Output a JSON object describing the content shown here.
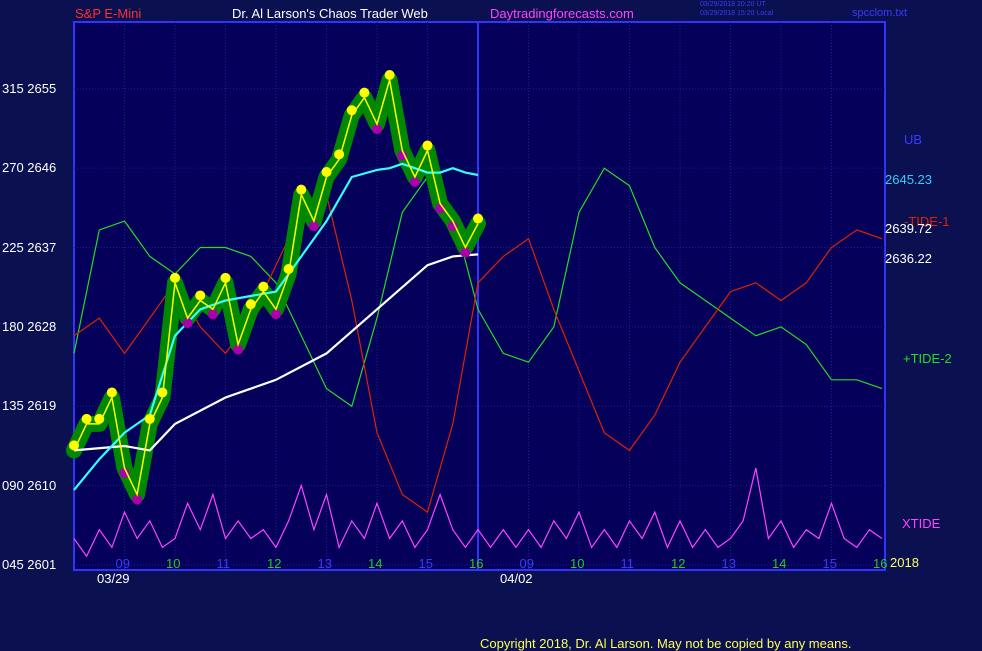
{
  "header": {
    "symbol": "S&P E-Mini",
    "title": "Dr. Al Larson's Chaos Trader Web",
    "site": "Daytradingforecasts.com",
    "time_ut": "03/29/2018 20:20 UT",
    "time_local": "03/29/2018 15:20 Local",
    "file": "spcclom.txt"
  },
  "footer": {
    "copyright": "Copyright 2018, Dr. Al Larson. May not be copied by any means."
  },
  "year_label": "2018",
  "colors": {
    "background": "#0a1050",
    "plot_bg": "#05005a",
    "price_bars": "#008800",
    "price_highs": "#ffff00",
    "price_lows": "#aa00aa",
    "emini_line": "#ffff00",
    "cyan_avg": "#33ffff",
    "white_avg": "#ffffff",
    "tide1": "#dd2200",
    "tide2": "#22dd22",
    "xtide": "#ff44ff",
    "axis": "#3333ff"
  },
  "chart_data": {
    "type": "line",
    "y_left_ticks": [
      {
        "osc": "045",
        "price": "2601"
      },
      {
        "osc": "090",
        "price": "2610"
      },
      {
        "osc": "135",
        "price": "2619"
      },
      {
        "osc": "180",
        "price": "2628"
      },
      {
        "osc": "225",
        "price": "2637"
      },
      {
        "osc": "270",
        "price": "2646"
      },
      {
        "osc": "315",
        "price": "2655"
      }
    ],
    "ylim_price": [
      2601,
      2656
    ],
    "x_hour_labels": [
      "09",
      "10",
      "11",
      "12",
      "13",
      "14",
      "15",
      "16",
      "09",
      "10",
      "11",
      "12",
      "13",
      "14",
      "15",
      "16"
    ],
    "x_date_labels": [
      "03/29",
      "04/02"
    ],
    "now_index": 8,
    "right_labels": {
      "ub": "UB",
      "cyan_value": "2645.23",
      "tide1": "-TIDE-1",
      "last_price": "2639.72",
      "white_value": "2636.22",
      "tide2": "+TIDE-2",
      "xtide": "XTIDE"
    },
    "series": [
      {
        "key": "price",
        "x": [
          0,
          0.25,
          0.5,
          0.75,
          1,
          1.25,
          1.5,
          1.75,
          2,
          2.25,
          2.5,
          2.75,
          3,
          3.25,
          3.5,
          3.75,
          4,
          4.25,
          4.5,
          4.75,
          5,
          5.25,
          5.5,
          5.75,
          6,
          6.25,
          6.5,
          6.75,
          7,
          7.25,
          7.5,
          7.75,
          8
        ],
        "y": [
          2614,
          2617,
          2617,
          2620,
          2612,
          2609,
          2617,
          2620,
          2633,
          2629,
          2631,
          2630,
          2633,
          2626,
          2630,
          2632,
          2630,
          2634,
          2643,
          2640,
          2645,
          2647,
          2652,
          2654,
          2651,
          2656,
          2648,
          2645,
          2648,
          2642,
          2640,
          2637,
          2639.72
        ]
      },
      {
        "key": "cyan",
        "x": [
          0,
          0.5,
          1,
          1.5,
          2,
          2.5,
          3,
          3.5,
          4,
          4.5,
          5,
          5.5,
          6,
          6.25,
          6.5,
          6.75,
          7,
          7.25,
          7.5,
          7.75,
          8
        ],
        "y": [
          2609.5,
          2613,
          2616,
          2618,
          2627,
          2630,
          2631,
          2631.5,
          2632,
          2636,
          2640,
          2645,
          2645.8,
          2646,
          2646.5,
          2646,
          2645.5,
          2645.5,
          2646,
          2645.5,
          2645.23
        ]
      },
      {
        "key": "white",
        "x": [
          0,
          1,
          1.5,
          2,
          3,
          4,
          5,
          6,
          7,
          7.5,
          8
        ],
        "y": [
          2614,
          2614.5,
          2614,
          2617,
          2620,
          2622,
          2625,
          2630,
          2635,
          2636,
          2636.22
        ]
      },
      {
        "key": "tide1",
        "x": [
          0,
          0.5,
          1,
          1.5,
          2,
          2.5,
          3,
          3.5,
          4,
          4.5,
          5,
          5.5,
          6,
          6.5,
          7,
          7.5,
          8,
          8.5,
          9,
          9.5,
          10,
          10.5,
          11,
          11.5,
          12,
          12.5,
          13,
          13.5,
          14,
          14.5,
          15,
          15.5,
          16
        ],
        "y": [
          2627,
          2629,
          2625,
          2629,
          2633,
          2628,
          2625,
          2629,
          2635,
          2641,
          2643,
          2631,
          2616,
          2609,
          2607,
          2617,
          2633,
          2636,
          2638,
          2630,
          2623,
          2616,
          2614,
          2618,
          2624,
          2628,
          2632,
          2633,
          2631,
          2633,
          2637,
          2639,
          2638
        ]
      },
      {
        "key": "tide2",
        "x": [
          0,
          0.5,
          1,
          1.5,
          2,
          2.5,
          3,
          3.5,
          4,
          4.5,
          5,
          5.5,
          6,
          6.5,
          7,
          7.5,
          8,
          8.5,
          9,
          9.5,
          10,
          10.5,
          11,
          11.5,
          12,
          12.5,
          13,
          13.5,
          14,
          14.5,
          15,
          15.5,
          16
        ],
        "y": [
          2625,
          2639,
          2640,
          2636,
          2634,
          2637,
          2637,
          2636,
          2633,
          2627,
          2621,
          2619,
          2629,
          2641,
          2645,
          2641,
          2630,
          2625,
          2624,
          2628,
          2641,
          2646,
          2644,
          2637,
          2633,
          2631,
          2629,
          2627,
          2628,
          2626,
          2622,
          2622,
          2621
        ]
      },
      {
        "key": "xtide",
        "x": [
          0,
          0.25,
          0.5,
          0.75,
          1,
          1.25,
          1.5,
          1.75,
          2,
          2.25,
          2.5,
          2.75,
          3,
          3.25,
          3.5,
          3.75,
          4,
          4.25,
          4.5,
          4.75,
          5,
          5.25,
          5.5,
          5.75,
          6,
          6.25,
          6.5,
          6.75,
          7,
          7.25,
          7.5,
          7.75,
          8,
          8.25,
          8.5,
          8.75,
          9,
          9.25,
          9.5,
          9.75,
          10,
          10.25,
          10.5,
          10.75,
          11,
          11.25,
          11.5,
          11.75,
          12,
          12.25,
          12.5,
          12.75,
          13,
          13.25,
          13.5,
          13.75,
          14,
          14.25,
          14.5,
          14.75,
          15,
          15.25,
          15.5,
          15.75,
          16
        ],
        "y": [
          2604,
          2602,
          2605,
          2603,
          2607,
          2604,
          2606,
          2603,
          2604,
          2608,
          2605,
          2609,
          2604,
          2606,
          2604,
          2605,
          2603,
          2606,
          2610,
          2605,
          2609,
          2603,
          2606,
          2604,
          2608,
          2604,
          2606,
          2603,
          2605,
          2609,
          2605,
          2603,
          2605,
          2603,
          2605,
          2603,
          2605,
          2603,
          2606,
          2604,
          2607,
          2603,
          2605,
          2603,
          2606,
          2604,
          2607,
          2603,
          2606,
          2603,
          2605,
          2603,
          2604,
          2606,
          2612,
          2604,
          2606,
          2603,
          2605,
          2604,
          2608,
          2604,
          2603,
          2605,
          2604
        ]
      }
    ]
  }
}
